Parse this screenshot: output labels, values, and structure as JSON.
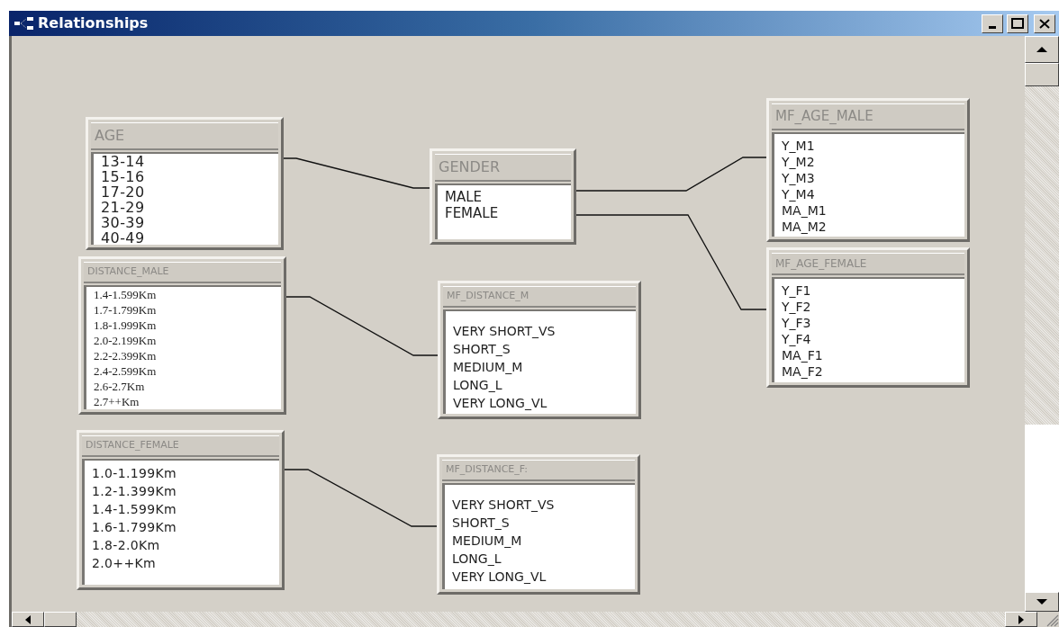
{
  "window": {
    "title": "Relationships"
  },
  "tables": [
    {
      "title": "AGE",
      "fields": [
        "13-14",
        "15-16",
        "17-20",
        "21-29",
        "30-39",
        "40-49"
      ]
    },
    {
      "title": "GENDER",
      "fields": [
        "MALE",
        "FEMALE"
      ]
    },
    {
      "title": "MF_AGE_MALE",
      "fields": [
        "Y_M1",
        "Y_M2",
        "Y_M3",
        "Y_M4",
        "MA_M1",
        "MA_M2"
      ]
    },
    {
      "title": "MF_AGE_FEMALE",
      "fields": [
        "Y_F1",
        "Y_F2",
        "Y_F3",
        "Y_F4",
        "MA_F1",
        "MA_F2"
      ]
    },
    {
      "title": "DISTANCE_MALE",
      "fields": [
        "1.4-1.599Km",
        "1.7-1.799Km",
        "1.8-1.999Km",
        "2.0-2.199Km",
        "2.2-2.399Km",
        "2.4-2.599Km",
        "2.6-2.7Km",
        "2.7++Km"
      ]
    },
    {
      "title": "MF_DISTANCE_M",
      "fields": [
        "VERY SHORT_VS",
        "SHORT_S",
        "MEDIUM_M",
        "LONG_L",
        "VERY LONG_VL"
      ]
    },
    {
      "title": "DISTANCE_FEMALE",
      "fields": [
        "1.0-1.199Km",
        "1.2-1.399Km",
        "1.4-1.599Km",
        "1.6-1.799Km",
        "1.8-2.0Km",
        "2.0++Km"
      ]
    },
    {
      "title": "MF_DISTANCE_F:",
      "fields": [
        "VERY SHORT_VS",
        "SHORT_S",
        "MEDIUM_M",
        "LONG_L",
        "VERY LONG_VL"
      ]
    }
  ]
}
